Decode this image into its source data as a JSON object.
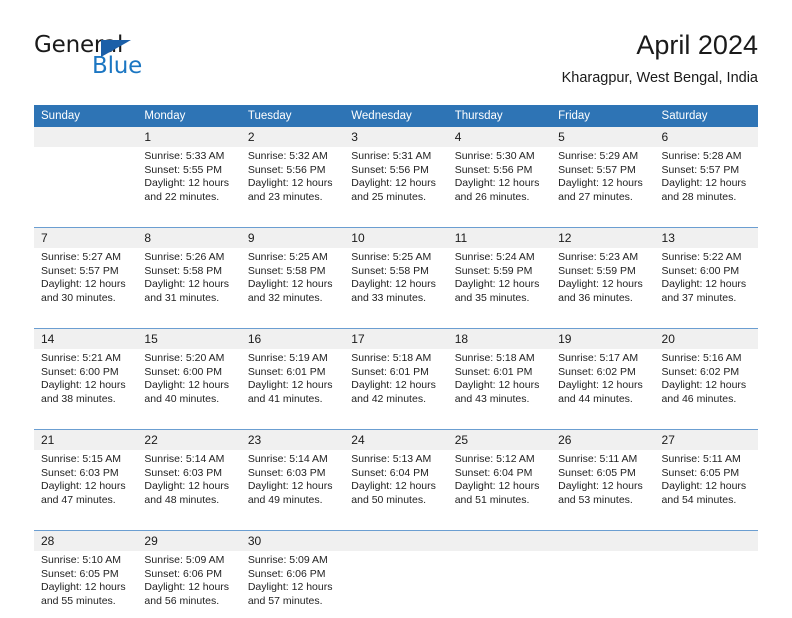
{
  "brand": {
    "name_part1": "General",
    "name_part2": "Blue",
    "triangle_color": "#1b5fa8",
    "blue_color": "#1b76c2"
  },
  "header": {
    "title": "April 2024",
    "location": "Kharagpur, West Bengal, India"
  },
  "theme": {
    "header_blue": "#2e74b5",
    "daynum_band": "#f0f0f0",
    "separator": "#6b9ed1"
  },
  "weekday_headers": [
    "Sunday",
    "Monday",
    "Tuesday",
    "Wednesday",
    "Thursday",
    "Friday",
    "Saturday"
  ],
  "weeks": [
    [
      {
        "day": "",
        "sunrise": "",
        "sunset": "",
        "daylight1": "",
        "daylight2": ""
      },
      {
        "day": "1",
        "sunrise": "Sunrise: 5:33 AM",
        "sunset": "Sunset: 5:55 PM",
        "daylight1": "Daylight: 12 hours",
        "daylight2": "and 22 minutes."
      },
      {
        "day": "2",
        "sunrise": "Sunrise: 5:32 AM",
        "sunset": "Sunset: 5:56 PM",
        "daylight1": "Daylight: 12 hours",
        "daylight2": "and 23 minutes."
      },
      {
        "day": "3",
        "sunrise": "Sunrise: 5:31 AM",
        "sunset": "Sunset: 5:56 PM",
        "daylight1": "Daylight: 12 hours",
        "daylight2": "and 25 minutes."
      },
      {
        "day": "4",
        "sunrise": "Sunrise: 5:30 AM",
        "sunset": "Sunset: 5:56 PM",
        "daylight1": "Daylight: 12 hours",
        "daylight2": "and 26 minutes."
      },
      {
        "day": "5",
        "sunrise": "Sunrise: 5:29 AM",
        "sunset": "Sunset: 5:57 PM",
        "daylight1": "Daylight: 12 hours",
        "daylight2": "and 27 minutes."
      },
      {
        "day": "6",
        "sunrise": "Sunrise: 5:28 AM",
        "sunset": "Sunset: 5:57 PM",
        "daylight1": "Daylight: 12 hours",
        "daylight2": "and 28 minutes."
      }
    ],
    [
      {
        "day": "7",
        "sunrise": "Sunrise: 5:27 AM",
        "sunset": "Sunset: 5:57 PM",
        "daylight1": "Daylight: 12 hours",
        "daylight2": "and 30 minutes."
      },
      {
        "day": "8",
        "sunrise": "Sunrise: 5:26 AM",
        "sunset": "Sunset: 5:58 PM",
        "daylight1": "Daylight: 12 hours",
        "daylight2": "and 31 minutes."
      },
      {
        "day": "9",
        "sunrise": "Sunrise: 5:25 AM",
        "sunset": "Sunset: 5:58 PM",
        "daylight1": "Daylight: 12 hours",
        "daylight2": "and 32 minutes."
      },
      {
        "day": "10",
        "sunrise": "Sunrise: 5:25 AM",
        "sunset": "Sunset: 5:58 PM",
        "daylight1": "Daylight: 12 hours",
        "daylight2": "and 33 minutes."
      },
      {
        "day": "11",
        "sunrise": "Sunrise: 5:24 AM",
        "sunset": "Sunset: 5:59 PM",
        "daylight1": "Daylight: 12 hours",
        "daylight2": "and 35 minutes."
      },
      {
        "day": "12",
        "sunrise": "Sunrise: 5:23 AM",
        "sunset": "Sunset: 5:59 PM",
        "daylight1": "Daylight: 12 hours",
        "daylight2": "and 36 minutes."
      },
      {
        "day": "13",
        "sunrise": "Sunrise: 5:22 AM",
        "sunset": "Sunset: 6:00 PM",
        "daylight1": "Daylight: 12 hours",
        "daylight2": "and 37 minutes."
      }
    ],
    [
      {
        "day": "14",
        "sunrise": "Sunrise: 5:21 AM",
        "sunset": "Sunset: 6:00 PM",
        "daylight1": "Daylight: 12 hours",
        "daylight2": "and 38 minutes."
      },
      {
        "day": "15",
        "sunrise": "Sunrise: 5:20 AM",
        "sunset": "Sunset: 6:00 PM",
        "daylight1": "Daylight: 12 hours",
        "daylight2": "and 40 minutes."
      },
      {
        "day": "16",
        "sunrise": "Sunrise: 5:19 AM",
        "sunset": "Sunset: 6:01 PM",
        "daylight1": "Daylight: 12 hours",
        "daylight2": "and 41 minutes."
      },
      {
        "day": "17",
        "sunrise": "Sunrise: 5:18 AM",
        "sunset": "Sunset: 6:01 PM",
        "daylight1": "Daylight: 12 hours",
        "daylight2": "and 42 minutes."
      },
      {
        "day": "18",
        "sunrise": "Sunrise: 5:18 AM",
        "sunset": "Sunset: 6:01 PM",
        "daylight1": "Daylight: 12 hours",
        "daylight2": "and 43 minutes."
      },
      {
        "day": "19",
        "sunrise": "Sunrise: 5:17 AM",
        "sunset": "Sunset: 6:02 PM",
        "daylight1": "Daylight: 12 hours",
        "daylight2": "and 44 minutes."
      },
      {
        "day": "20",
        "sunrise": "Sunrise: 5:16 AM",
        "sunset": "Sunset: 6:02 PM",
        "daylight1": "Daylight: 12 hours",
        "daylight2": "and 46 minutes."
      }
    ],
    [
      {
        "day": "21",
        "sunrise": "Sunrise: 5:15 AM",
        "sunset": "Sunset: 6:03 PM",
        "daylight1": "Daylight: 12 hours",
        "daylight2": "and 47 minutes."
      },
      {
        "day": "22",
        "sunrise": "Sunrise: 5:14 AM",
        "sunset": "Sunset: 6:03 PM",
        "daylight1": "Daylight: 12 hours",
        "daylight2": "and 48 minutes."
      },
      {
        "day": "23",
        "sunrise": "Sunrise: 5:14 AM",
        "sunset": "Sunset: 6:03 PM",
        "daylight1": "Daylight: 12 hours",
        "daylight2": "and 49 minutes."
      },
      {
        "day": "24",
        "sunrise": "Sunrise: 5:13 AM",
        "sunset": "Sunset: 6:04 PM",
        "daylight1": "Daylight: 12 hours",
        "daylight2": "and 50 minutes."
      },
      {
        "day": "25",
        "sunrise": "Sunrise: 5:12 AM",
        "sunset": "Sunset: 6:04 PM",
        "daylight1": "Daylight: 12 hours",
        "daylight2": "and 51 minutes."
      },
      {
        "day": "26",
        "sunrise": "Sunrise: 5:11 AM",
        "sunset": "Sunset: 6:05 PM",
        "daylight1": "Daylight: 12 hours",
        "daylight2": "and 53 minutes."
      },
      {
        "day": "27",
        "sunrise": "Sunrise: 5:11 AM",
        "sunset": "Sunset: 6:05 PM",
        "daylight1": "Daylight: 12 hours",
        "daylight2": "and 54 minutes."
      }
    ],
    [
      {
        "day": "28",
        "sunrise": "Sunrise: 5:10 AM",
        "sunset": "Sunset: 6:05 PM",
        "daylight1": "Daylight: 12 hours",
        "daylight2": "and 55 minutes."
      },
      {
        "day": "29",
        "sunrise": "Sunrise: 5:09 AM",
        "sunset": "Sunset: 6:06 PM",
        "daylight1": "Daylight: 12 hours",
        "daylight2": "and 56 minutes."
      },
      {
        "day": "30",
        "sunrise": "Sunrise: 5:09 AM",
        "sunset": "Sunset: 6:06 PM",
        "daylight1": "Daylight: 12 hours",
        "daylight2": "and 57 minutes."
      },
      {
        "day": "",
        "sunrise": "",
        "sunset": "",
        "daylight1": "",
        "daylight2": ""
      },
      {
        "day": "",
        "sunrise": "",
        "sunset": "",
        "daylight1": "",
        "daylight2": ""
      },
      {
        "day": "",
        "sunrise": "",
        "sunset": "",
        "daylight1": "",
        "daylight2": ""
      },
      {
        "day": "",
        "sunrise": "",
        "sunset": "",
        "daylight1": "",
        "daylight2": ""
      }
    ]
  ]
}
